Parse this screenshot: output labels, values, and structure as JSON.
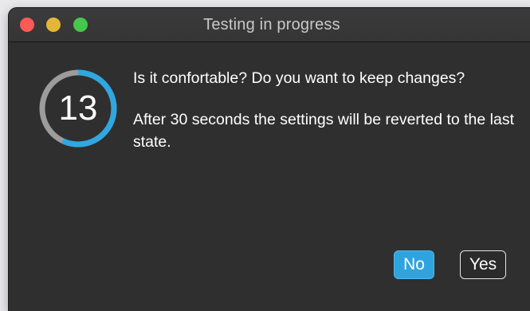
{
  "window": {
    "title": "Testing in progress"
  },
  "traffic_lights": {
    "close_color": "#fc5a54",
    "minimize_color": "#e3b638",
    "zoom_color": "#44c74a"
  },
  "timer": {
    "value": "13",
    "elapsed_fraction": 0.43,
    "track_color": "#9c9c9c",
    "progress_color": "#2fa7e2"
  },
  "message": {
    "question": "Is it confortable? Do you want to keep changes?",
    "detail": "After 30 seconds the settings will be reverted to the last state."
  },
  "buttons": {
    "no_label": "No",
    "yes_label": "Yes"
  },
  "colors": {
    "accent": "#2fa3dd",
    "window_bg": "#2f2f2f"
  }
}
